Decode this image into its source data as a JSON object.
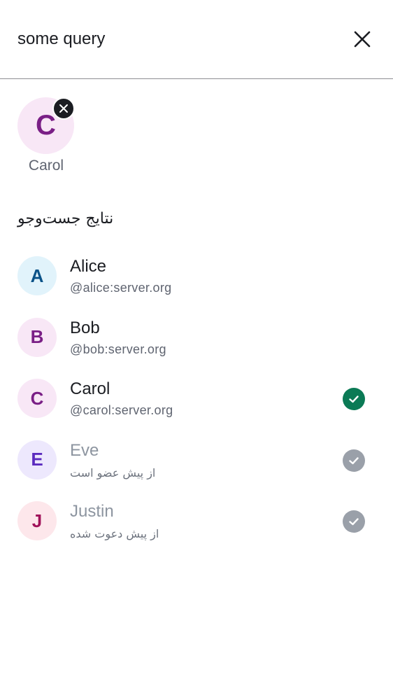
{
  "search": {
    "value": "some query",
    "close_icon": "close-icon"
  },
  "selected": [
    {
      "initial": "C",
      "label": "Carol",
      "avatar_bg": "#f8e7f6",
      "avatar_fg": "#7a1f86",
      "remove_icon": "close-icon"
    }
  ],
  "results": {
    "heading": "نتایج جست‌وجو",
    "items": [
      {
        "initial": "A",
        "name": "Alice",
        "subtitle": "@alice:server.org",
        "avatar_bg": "#e1f3fb",
        "avatar_fg": "#0a5288",
        "state": "unselected"
      },
      {
        "initial": "B",
        "name": "Bob",
        "subtitle": "@bob:server.org",
        "avatar_bg": "#f8e7f6",
        "avatar_fg": "#7a1f86",
        "state": "unselected"
      },
      {
        "initial": "C",
        "name": "Carol",
        "subtitle": "@carol:server.org",
        "avatar_bg": "#f8e7f6",
        "avatar_fg": "#7a1f86",
        "state": "selected",
        "check_color": "#0b7a55"
      },
      {
        "initial": "E",
        "name": "Eve",
        "subtitle": "از پیش عضو است",
        "avatar_bg": "#ede8fd",
        "avatar_fg": "#5b2bbf",
        "state": "disabled",
        "check_color": "#9aa0a9"
      },
      {
        "initial": "J",
        "name": "Justin",
        "subtitle": "از پیش دعوت شده",
        "avatar_bg": "#fde7eb",
        "avatar_fg": "#a1135a",
        "state": "disabled",
        "check_color": "#9aa0a9"
      }
    ]
  }
}
